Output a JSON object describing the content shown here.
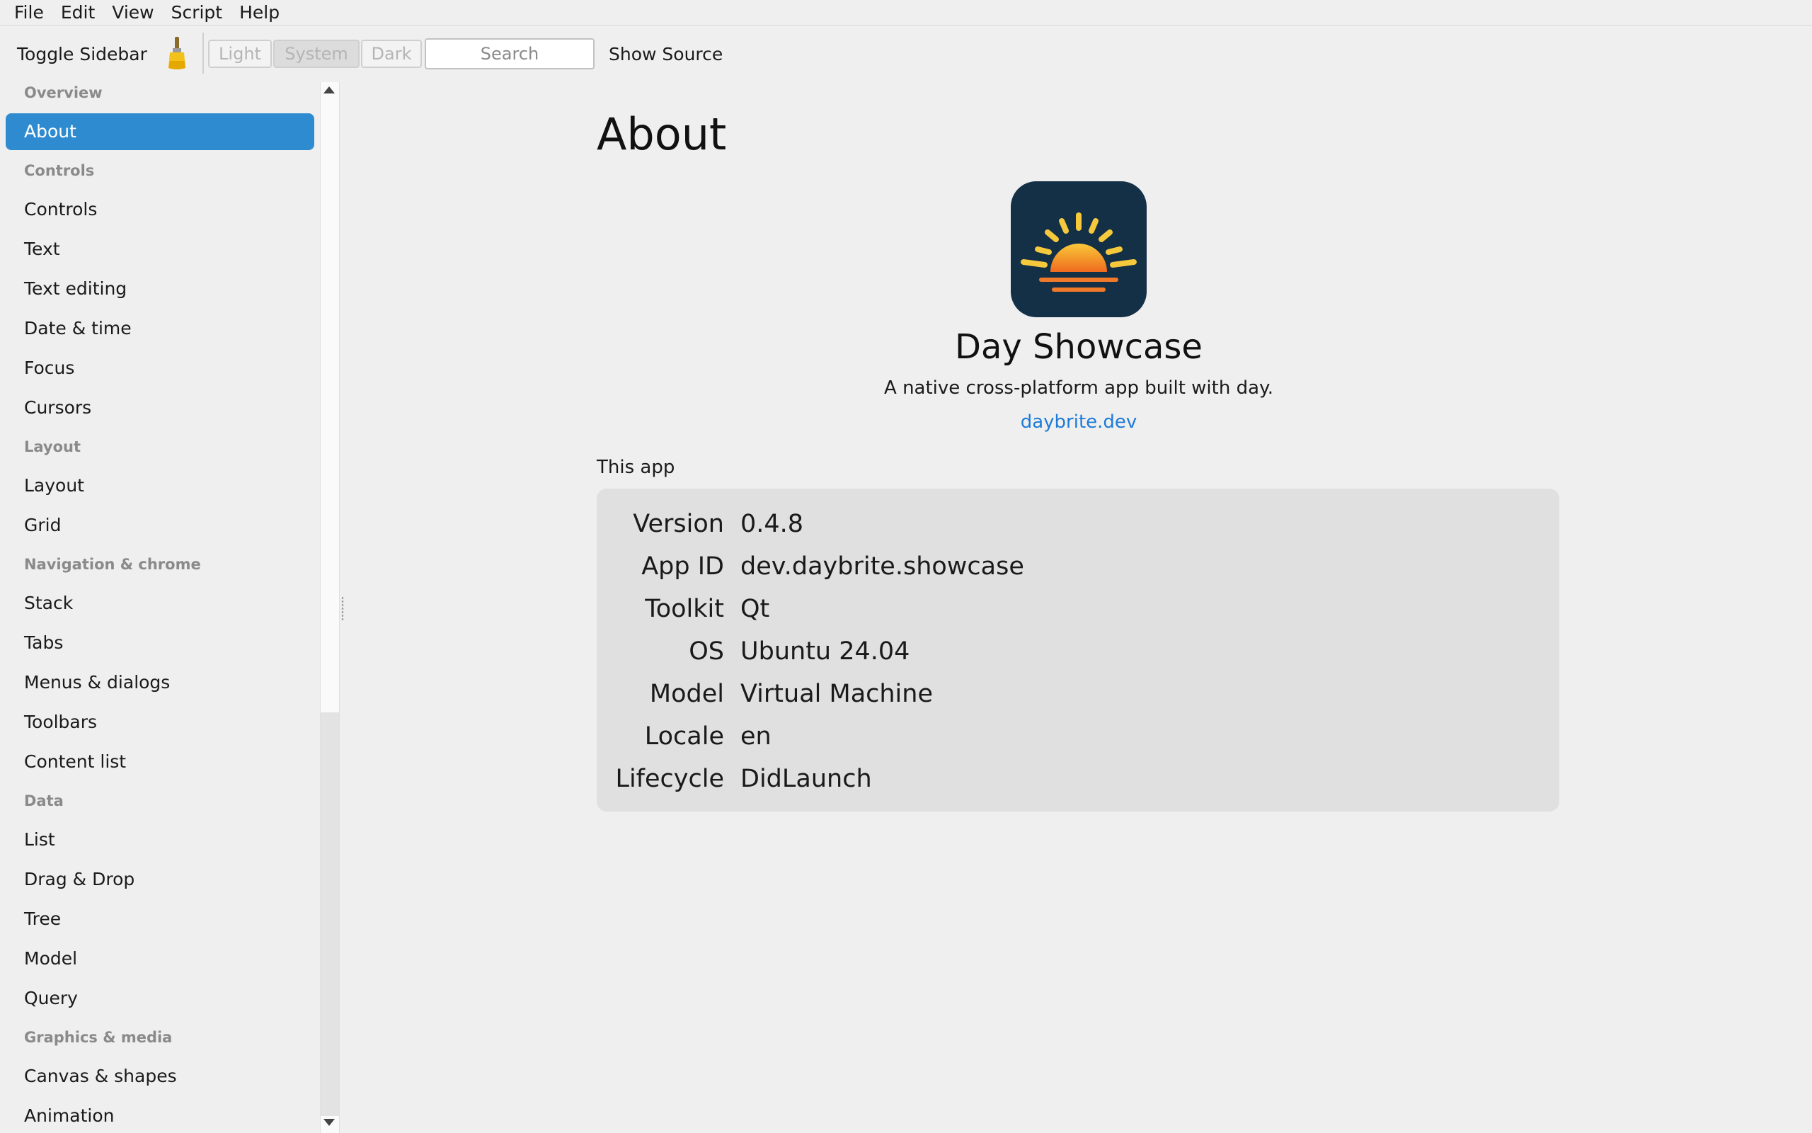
{
  "menubar": {
    "items": [
      "File",
      "Edit",
      "View",
      "Script",
      "Help"
    ]
  },
  "toolbar": {
    "toggle_sidebar": "Toggle Sidebar",
    "theme_icon": "paintbrush-icon",
    "theme_options": [
      "Light",
      "System",
      "Dark"
    ],
    "theme_selected": "System",
    "search_placeholder": "Search",
    "search_value": "",
    "show_source": "Show Source"
  },
  "sidebar": {
    "selected": "About",
    "accent_color": "#2f8bd0",
    "sections": [
      {
        "heading": "Overview",
        "items": [
          "About"
        ]
      },
      {
        "heading": "Controls",
        "items": [
          "Controls",
          "Text",
          "Text editing",
          "Date & time",
          "Focus",
          "Cursors"
        ]
      },
      {
        "heading": "Layout",
        "items": [
          "Layout",
          "Grid"
        ]
      },
      {
        "heading": "Navigation & chrome",
        "items": [
          "Stack",
          "Tabs",
          "Menus & dialogs",
          "Toolbars",
          "Content list"
        ]
      },
      {
        "heading": "Data",
        "items": [
          "List",
          "Drag & Drop",
          "Tree",
          "Model",
          "Query"
        ]
      },
      {
        "heading": "Graphics & media",
        "items": [
          "Canvas & shapes",
          "Animation"
        ]
      }
    ]
  },
  "main": {
    "title": "About",
    "app_icon": "sunrise-app-icon",
    "app_name": "Day Showcase",
    "tagline": "A native cross-platform app built with day.",
    "link": "daybrite.dev",
    "link_color": "#1e7bd8",
    "section_label": "This app",
    "info": [
      {
        "key": "Version",
        "value": "0.4.8"
      },
      {
        "key": "App ID",
        "value": "dev.daybrite.showcase"
      },
      {
        "key": "Toolkit",
        "value": "Qt"
      },
      {
        "key": "OS",
        "value": "Ubuntu 24.04"
      },
      {
        "key": "Model",
        "value": "Virtual Machine"
      },
      {
        "key": "Locale",
        "value": "en"
      },
      {
        "key": "Lifecycle",
        "value": "DidLaunch"
      }
    ]
  }
}
